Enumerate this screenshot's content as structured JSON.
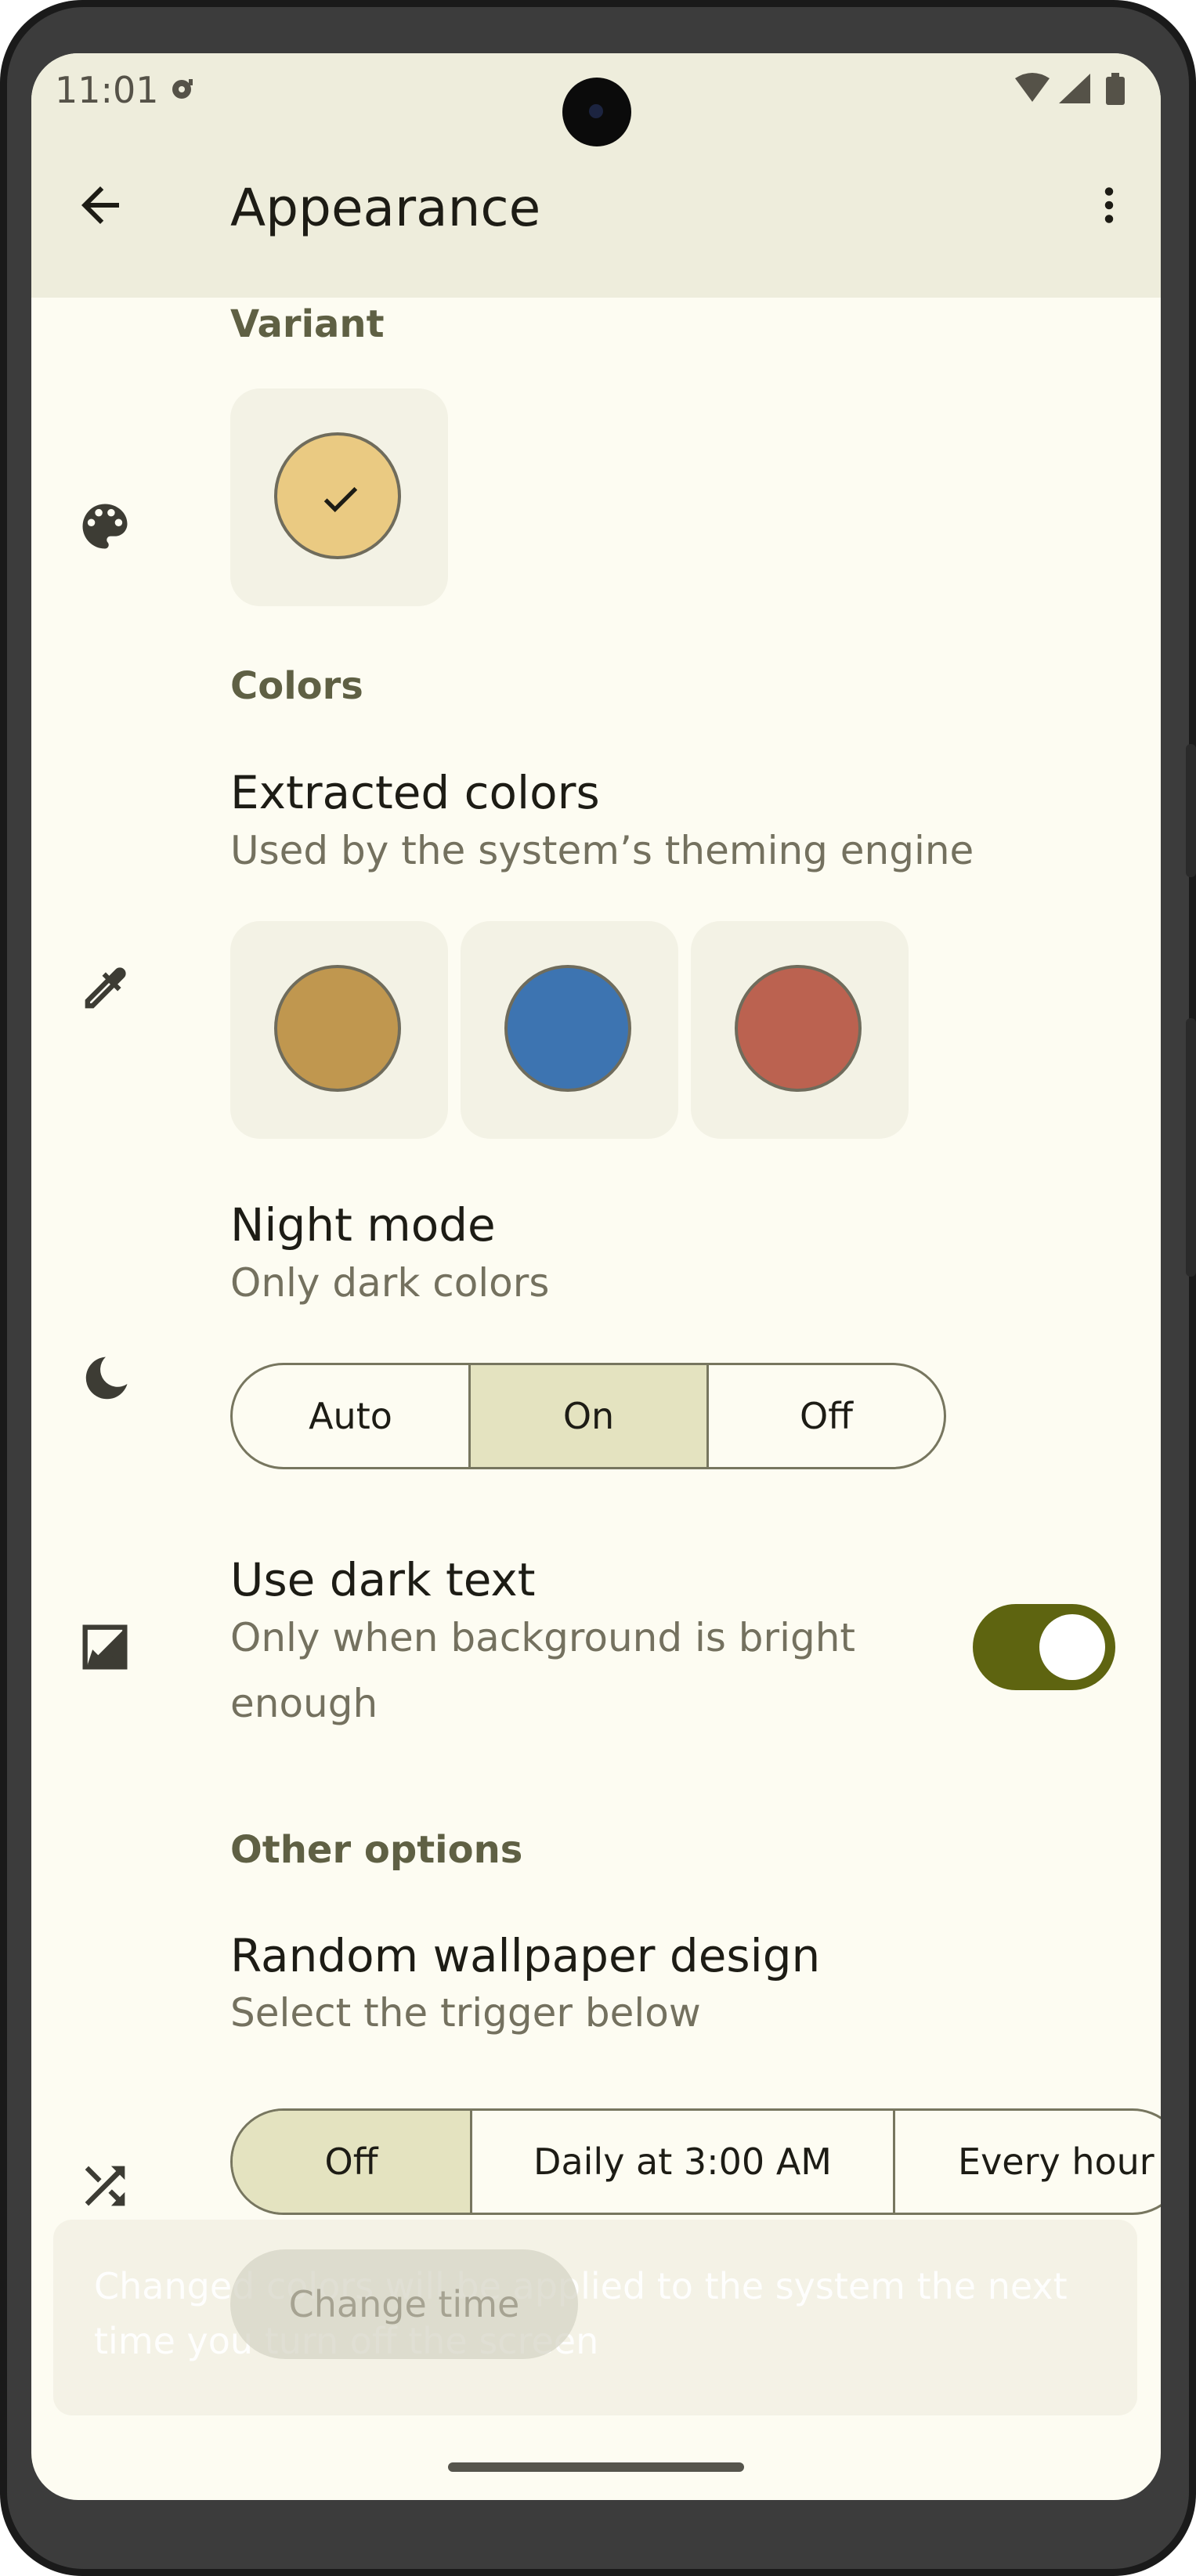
{
  "status": {
    "time": "11:01"
  },
  "header": {
    "title": "Appearance",
    "back_icon": "arrow-back-icon",
    "menu_icon": "more-vert-icon"
  },
  "variant": {
    "heading": "Variant",
    "icon": "palette-icon",
    "swatches": [
      {
        "color": "#eaca82",
        "selected": true
      }
    ]
  },
  "colors": {
    "heading": "Colors",
    "extracted": {
      "title": "Extracted colors",
      "subtitle": "Used by the system’s theming engine",
      "icon": "eyedropper-icon",
      "swatches": [
        "#c0974f",
        "#3d74b1",
        "#bb6250"
      ]
    },
    "night_mode": {
      "title": "Night mode",
      "subtitle": "Only dark colors",
      "icon": "moon-icon",
      "options": [
        "Auto",
        "On",
        "Off"
      ],
      "selected": "On"
    },
    "dark_text": {
      "title": "Use dark text",
      "subtitle": "Only when background is bright enough",
      "icon": "contrast-icon",
      "enabled": true
    }
  },
  "other": {
    "heading": "Other options",
    "random": {
      "title": "Random wallpaper design",
      "subtitle": "Select the trigger below",
      "icon": "shuffle-icon",
      "options": [
        "Off",
        "Daily at 3:00 AM",
        "Every hour"
      ],
      "selected": "Off"
    }
  },
  "snackbar": {
    "message": "Changed colors will be applied to the system the next time you turn off the screen",
    "action": "Change time"
  },
  "theme": {
    "accent": "#5e6410",
    "background": "#fdfcf2",
    "top_bar": "#eeeddc"
  }
}
